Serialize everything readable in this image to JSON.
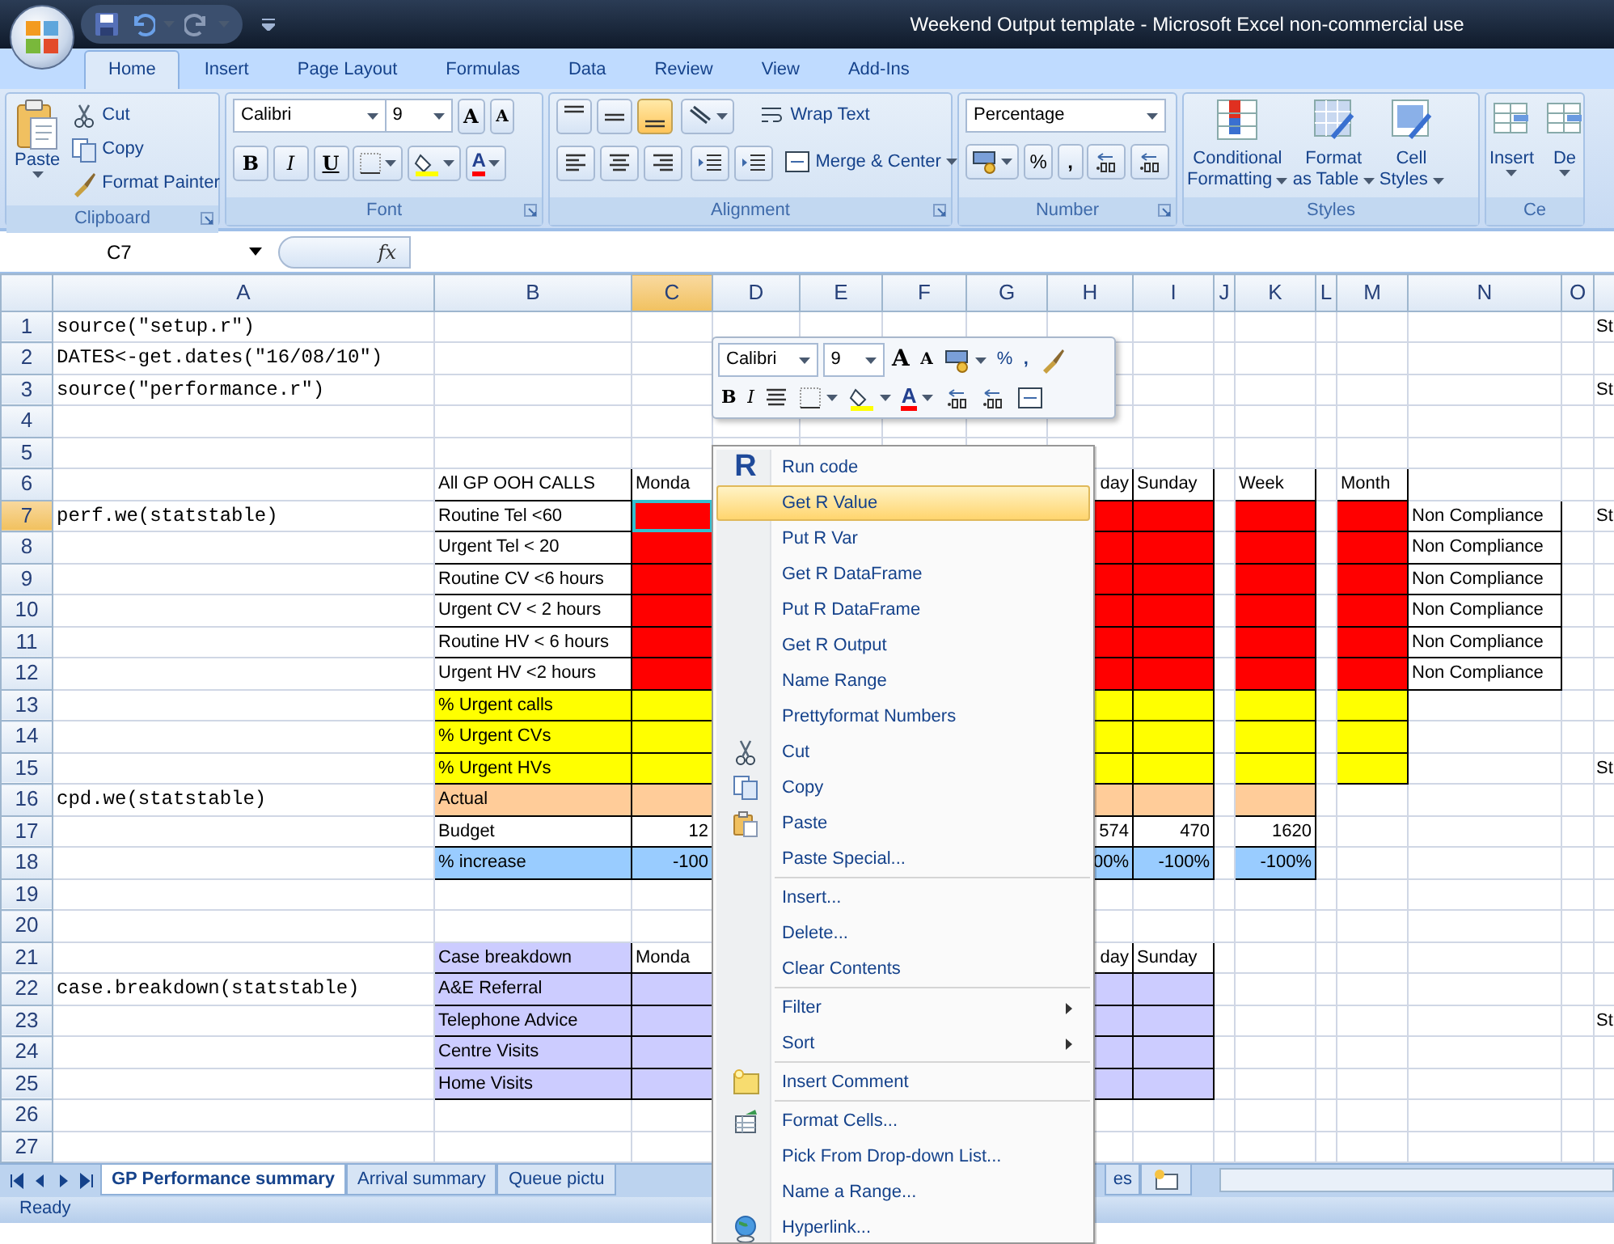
{
  "window": {
    "title": "Weekend Output template - Microsoft Excel non-commercial use"
  },
  "ribbon": {
    "tabs": [
      {
        "label": "Home",
        "selected": true
      },
      {
        "label": "Insert",
        "selected": false
      },
      {
        "label": "Page Layout",
        "selected": false
      },
      {
        "label": "Formulas",
        "selected": false
      },
      {
        "label": "Data",
        "selected": false
      },
      {
        "label": "Review",
        "selected": false
      },
      {
        "label": "View",
        "selected": false
      },
      {
        "label": "Add-Ins",
        "selected": false
      }
    ],
    "clipboard": {
      "label": "Clipboard",
      "paste": "Paste",
      "items": [
        "Cut",
        "Copy",
        "Format Painter"
      ]
    },
    "font": {
      "label": "Font",
      "font_name": "Calibri",
      "font_size": "9",
      "grow": "A",
      "shrink": "A",
      "styles": [
        "B",
        "I",
        "U"
      ],
      "color_letter": "A"
    },
    "alignment": {
      "label": "Alignment",
      "wrap": "Wrap Text",
      "merge": "Merge & Center",
      "bottom_align_on": true
    },
    "number": {
      "label": "Number",
      "format": "Percentage",
      "percent": "%",
      "comma": ","
    },
    "styles": {
      "label": "Styles",
      "buttons": [
        {
          "line1": "Conditional",
          "line2": "Formatting"
        },
        {
          "line1": "Format",
          "line2": "as Table"
        },
        {
          "line1": "Cell",
          "line2": "Styles"
        }
      ]
    },
    "cells": {
      "label": "Ce",
      "buttons": [
        "Insert",
        "De"
      ]
    }
  },
  "formula_bar": {
    "name_box": "C7",
    "fx": "fx"
  },
  "sheet": {
    "columns": [
      {
        "label": "A",
        "selected": false
      },
      {
        "label": "B",
        "selected": false
      },
      {
        "label": "C",
        "selected": true
      },
      {
        "label": "D",
        "selected": false
      },
      {
        "label": "E",
        "selected": false
      },
      {
        "label": "F",
        "selected": false
      },
      {
        "label": "G",
        "selected": false
      },
      {
        "label": "H",
        "selected": false
      },
      {
        "label": "I",
        "selected": false
      },
      {
        "label": "J",
        "selected": false
      },
      {
        "label": "K",
        "selected": false
      },
      {
        "label": "L",
        "selected": false
      },
      {
        "label": "M",
        "selected": false
      },
      {
        "label": "N",
        "selected": false
      },
      {
        "label": "O",
        "selected": false
      }
    ],
    "rows": [
      {
        "number": "1",
        "selected": false,
        "cells": [
          {
            "kind": "code",
            "text": "source(\"setup.r\")"
          },
          {},
          {},
          {},
          {},
          {},
          {},
          {},
          {},
          {},
          {},
          {},
          {},
          {},
          {},
          {
            "kind": "label",
            "text": "St"
          }
        ]
      },
      {
        "number": "2",
        "selected": false,
        "cells": [
          {
            "kind": "code",
            "text": "DATES<-get.dates(\"16/08/10\")"
          }
        ]
      },
      {
        "number": "3",
        "selected": false,
        "cells": [
          {
            "kind": "code",
            "text": "source(\"performance.r\")"
          },
          {},
          {},
          {},
          {},
          {},
          {},
          {},
          {},
          {},
          {},
          {},
          {},
          {},
          {},
          {
            "kind": "label",
            "text": "St"
          }
        ]
      },
      {
        "number": "4",
        "selected": false,
        "cells": []
      },
      {
        "number": "5",
        "selected": false,
        "cells": []
      },
      {
        "number": "6",
        "selected": false,
        "cells": [
          {},
          {
            "kind": "label",
            "text": "All GP OOH CALLS",
            "boxed": true
          },
          {
            "kind": "label",
            "text": "Monda",
            "boxed": true
          },
          {},
          {},
          {},
          {},
          {
            "kind": "tail",
            "text": "day",
            "boxed": true
          },
          {
            "kind": "label",
            "text": "Sunday",
            "boxed": true
          },
          {},
          {
            "kind": "label",
            "text": "Week",
            "boxed": true
          },
          {},
          {
            "kind": "label",
            "text": "Month",
            "boxed": true
          }
        ]
      },
      {
        "number": "7",
        "selected": true,
        "cells": [
          {
            "kind": "code",
            "text": "perf.we(statstable)"
          },
          {
            "kind": "label",
            "text": "Routine Tel <60",
            "boxed": true
          },
          {
            "kind": "label",
            "boxed": true,
            "color": "#ff0000",
            "active": true
          },
          {},
          {},
          {},
          {},
          {
            "kind": "label",
            "boxed": true,
            "color": "#ff0000"
          },
          {
            "kind": "label",
            "boxed": true,
            "color": "#ff0000"
          },
          {},
          {
            "kind": "label",
            "boxed": true,
            "color": "#ff0000"
          },
          {},
          {
            "kind": "label",
            "boxed": true,
            "color": "#ff0000"
          },
          {
            "kind": "label",
            "text": "Non Compliance",
            "boxed": true
          },
          {},
          {
            "kind": "label",
            "text": "St"
          }
        ]
      },
      {
        "number": "8",
        "selected": false,
        "cells": [
          {},
          {
            "kind": "label",
            "text": "Urgent Tel < 20",
            "boxed": true
          },
          {
            "kind": "label",
            "boxed": true,
            "color": "#ff0000"
          },
          {},
          {},
          {},
          {},
          {
            "kind": "label",
            "boxed": true,
            "color": "#ff0000"
          },
          {
            "kind": "label",
            "boxed": true,
            "color": "#ff0000"
          },
          {},
          {
            "kind": "label",
            "boxed": true,
            "color": "#ff0000"
          },
          {},
          {
            "kind": "label",
            "boxed": true,
            "color": "#ff0000"
          },
          {
            "kind": "label",
            "text": "Non Compliance",
            "boxed": true
          }
        ]
      },
      {
        "number": "9",
        "selected": false,
        "cells": [
          {},
          {
            "kind": "label",
            "text": "Routine CV <6 hours",
            "boxed": true
          },
          {
            "kind": "label",
            "boxed": true,
            "color": "#ff0000"
          },
          {},
          {},
          {},
          {},
          {
            "kind": "label",
            "boxed": true,
            "color": "#ff0000"
          },
          {
            "kind": "label",
            "boxed": true,
            "color": "#ff0000"
          },
          {},
          {
            "kind": "label",
            "boxed": true,
            "color": "#ff0000"
          },
          {},
          {
            "kind": "label",
            "boxed": true,
            "color": "#ff0000"
          },
          {
            "kind": "label",
            "text": "Non Compliance",
            "boxed": true
          }
        ]
      },
      {
        "number": "10",
        "selected": false,
        "cells": [
          {},
          {
            "kind": "label",
            "text": "Urgent CV < 2 hours",
            "boxed": true
          },
          {
            "kind": "label",
            "boxed": true,
            "color": "#ff0000"
          },
          {},
          {},
          {},
          {},
          {
            "kind": "label",
            "boxed": true,
            "color": "#ff0000"
          },
          {
            "kind": "label",
            "boxed": true,
            "color": "#ff0000"
          },
          {},
          {
            "kind": "label",
            "boxed": true,
            "color": "#ff0000"
          },
          {},
          {
            "kind": "label",
            "boxed": true,
            "color": "#ff0000"
          },
          {
            "kind": "label",
            "text": "Non Compliance",
            "boxed": true
          }
        ]
      },
      {
        "number": "11",
        "selected": false,
        "cells": [
          {},
          {
            "kind": "label",
            "text": "Routine HV < 6 hours",
            "boxed": true
          },
          {
            "kind": "label",
            "boxed": true,
            "color": "#ff0000"
          },
          {},
          {},
          {},
          {},
          {
            "kind": "label",
            "boxed": true,
            "color": "#ff0000"
          },
          {
            "kind": "label",
            "boxed": true,
            "color": "#ff0000"
          },
          {},
          {
            "kind": "label",
            "boxed": true,
            "color": "#ff0000"
          },
          {},
          {
            "kind": "label",
            "boxed": true,
            "color": "#ff0000"
          },
          {
            "kind": "label",
            "text": "Non Compliance",
            "boxed": true
          }
        ]
      },
      {
        "number": "12",
        "selected": false,
        "cells": [
          {},
          {
            "kind": "label",
            "text": "Urgent HV <2 hours",
            "boxed": true
          },
          {
            "kind": "label",
            "boxed": true,
            "color": "#ff0000"
          },
          {},
          {},
          {},
          {},
          {
            "kind": "label",
            "boxed": true,
            "color": "#ff0000"
          },
          {
            "kind": "label",
            "boxed": true,
            "color": "#ff0000"
          },
          {},
          {
            "kind": "label",
            "boxed": true,
            "color": "#ff0000"
          },
          {},
          {
            "kind": "label",
            "boxed": true,
            "color": "#ff0000"
          },
          {
            "kind": "label",
            "text": "Non Compliance",
            "boxed": true
          }
        ]
      },
      {
        "number": "13",
        "selected": false,
        "cells": [
          {},
          {
            "kind": "label",
            "text": "% Urgent calls",
            "boxed": true,
            "color": "#ffff00"
          },
          {
            "kind": "label",
            "boxed": true,
            "color": "#ffff00"
          },
          {},
          {},
          {},
          {},
          {
            "kind": "label",
            "boxed": true,
            "color": "#ffff00"
          },
          {
            "kind": "label",
            "boxed": true,
            "color": "#ffff00"
          },
          {},
          {
            "kind": "label",
            "boxed": true,
            "color": "#ffff00"
          },
          {},
          {
            "kind": "label",
            "boxed": true,
            "color": "#ffff00"
          }
        ]
      },
      {
        "number": "14",
        "selected": false,
        "cells": [
          {},
          {
            "kind": "label",
            "text": "% Urgent CVs",
            "boxed": true,
            "color": "#ffff00"
          },
          {
            "kind": "label",
            "boxed": true,
            "color": "#ffff00"
          },
          {},
          {},
          {},
          {},
          {
            "kind": "label",
            "boxed": true,
            "color": "#ffff00"
          },
          {
            "kind": "label",
            "boxed": true,
            "color": "#ffff00"
          },
          {},
          {
            "kind": "label",
            "boxed": true,
            "color": "#ffff00"
          },
          {},
          {
            "kind": "label",
            "boxed": true,
            "color": "#ffff00"
          }
        ]
      },
      {
        "number": "15",
        "selected": false,
        "cells": [
          {},
          {
            "kind": "label",
            "text": "% Urgent HVs",
            "boxed": true,
            "color": "#ffff00"
          },
          {
            "kind": "label",
            "boxed": true,
            "color": "#ffff00"
          },
          {},
          {},
          {},
          {},
          {
            "kind": "label",
            "boxed": true,
            "color": "#ffff00"
          },
          {
            "kind": "label",
            "boxed": true,
            "color": "#ffff00"
          },
          {},
          {
            "kind": "label",
            "boxed": true,
            "color": "#ffff00"
          },
          {},
          {
            "kind": "label",
            "boxed": true,
            "color": "#ffff00"
          },
          {},
          {},
          {
            "kind": "label",
            "text": "St"
          }
        ]
      },
      {
        "number": "16",
        "selected": false,
        "cells": [
          {
            "kind": "code",
            "text": "cpd.we(statstable)"
          },
          {
            "kind": "label",
            "text": "Actual",
            "boxed": true,
            "color": "#ffcc99"
          },
          {
            "kind": "label",
            "boxed": true,
            "color": "#ffcc99"
          },
          {},
          {},
          {},
          {},
          {
            "kind": "label",
            "boxed": true,
            "color": "#ffcc99"
          },
          {
            "kind": "label",
            "boxed": true,
            "color": "#ffcc99"
          },
          {},
          {
            "kind": "label",
            "boxed": true,
            "color": "#ffcc99"
          }
        ]
      },
      {
        "number": "17",
        "selected": false,
        "cells": [
          {},
          {
            "kind": "label",
            "text": "Budget",
            "boxed": true
          },
          {
            "kind": "number",
            "text": "12",
            "boxed": true
          },
          {},
          {},
          {},
          {},
          {
            "kind": "number",
            "text": "574",
            "boxed": true
          },
          {
            "kind": "number",
            "text": "470",
            "boxed": true
          },
          {},
          {
            "kind": "number",
            "text": "1620",
            "boxed": true
          }
        ]
      },
      {
        "number": "18",
        "selected": false,
        "cells": [
          {},
          {
            "kind": "label",
            "text": "% increase",
            "boxed": true,
            "color": "#99ccff"
          },
          {
            "kind": "number",
            "text": "-100",
            "boxed": true,
            "color": "#99ccff"
          },
          {},
          {},
          {},
          {},
          {
            "kind": "number",
            "text": "00%",
            "boxed": true,
            "color": "#99ccff"
          },
          {
            "kind": "number",
            "text": "-100%",
            "boxed": true,
            "color": "#99ccff"
          },
          {},
          {
            "kind": "number",
            "text": "-100%",
            "boxed": true,
            "color": "#99ccff"
          }
        ]
      },
      {
        "number": "19",
        "selected": false,
        "cells": []
      },
      {
        "number": "20",
        "selected": false,
        "cells": []
      },
      {
        "number": "21",
        "selected": false,
        "cells": [
          {},
          {
            "kind": "label",
            "text": "Case breakdown",
            "boxed": true,
            "color": "#ccccff"
          },
          {
            "kind": "label",
            "text": "Monda",
            "boxed": true
          },
          {},
          {},
          {},
          {},
          {
            "kind": "tail",
            "text": "day",
            "boxed": true
          },
          {
            "kind": "label",
            "text": "Sunday",
            "boxed": true
          }
        ]
      },
      {
        "number": "22",
        "selected": false,
        "cells": [
          {
            "kind": "code",
            "text": "case.breakdown(statstable)"
          },
          {
            "kind": "label",
            "text": "A&E Referral",
            "boxed": true,
            "color": "#ccccff"
          },
          {
            "kind": "label",
            "boxed": true,
            "color": "#ccccff"
          },
          {},
          {},
          {},
          {},
          {
            "kind": "label",
            "boxed": true,
            "color": "#ccccff"
          },
          {
            "kind": "label",
            "boxed": true,
            "color": "#ccccff"
          }
        ]
      },
      {
        "number": "23",
        "selected": false,
        "cells": [
          {},
          {
            "kind": "label",
            "text": "Telephone Advice",
            "boxed": true,
            "color": "#ccccff"
          },
          {
            "kind": "label",
            "boxed": true,
            "color": "#ccccff"
          },
          {},
          {},
          {},
          {},
          {
            "kind": "label",
            "boxed": true,
            "color": "#ccccff"
          },
          {
            "kind": "label",
            "boxed": true,
            "color": "#ccccff"
          },
          {},
          {},
          {},
          {},
          {},
          {},
          {
            "kind": "label",
            "text": "St"
          }
        ]
      },
      {
        "number": "24",
        "selected": false,
        "cells": [
          {},
          {
            "kind": "label",
            "text": "Centre Visits",
            "boxed": true,
            "color": "#ccccff"
          },
          {
            "kind": "label",
            "boxed": true,
            "color": "#ccccff"
          },
          {},
          {},
          {},
          {},
          {
            "kind": "label",
            "boxed": true,
            "color": "#ccccff"
          },
          {
            "kind": "label",
            "boxed": true,
            "color": "#ccccff"
          }
        ]
      },
      {
        "number": "25",
        "selected": false,
        "cells": [
          {},
          {
            "kind": "label",
            "text": "Home Visits",
            "boxed": true,
            "color": "#ccccff"
          },
          {
            "kind": "label",
            "boxed": true,
            "color": "#ccccff"
          },
          {},
          {},
          {},
          {},
          {
            "kind": "label",
            "boxed": true,
            "color": "#ccccff"
          },
          {
            "kind": "label",
            "boxed": true,
            "color": "#ccccff"
          }
        ]
      },
      {
        "number": "26",
        "selected": false,
        "cells": []
      },
      {
        "number": "27",
        "selected": false,
        "cells": []
      }
    ]
  },
  "mini_toolbar": {
    "font_name": "Calibri",
    "font_size": "9",
    "grow": "A",
    "shrink": "A",
    "percent": "%",
    "comma": ",",
    "bold": "B",
    "italic": "I",
    "color_letter": "A"
  },
  "context_menu": {
    "items": [
      {
        "kind": "item",
        "label": "Run code",
        "badge": "R",
        "selected": false
      },
      {
        "kind": "item",
        "label": "Get R Value",
        "selected": true
      },
      {
        "kind": "item",
        "label": "Put R Var",
        "selected": false
      },
      {
        "kind": "item",
        "label": "Get R DataFrame",
        "selected": false
      },
      {
        "kind": "item",
        "label": "Put R DataFrame",
        "selected": false
      },
      {
        "kind": "item",
        "label": "Get R Output",
        "selected": false
      },
      {
        "kind": "item",
        "label": "Name Range",
        "selected": false
      },
      {
        "kind": "item",
        "label": "Prettyformat Numbers",
        "selected": false
      },
      {
        "kind": "item",
        "label": "Cut",
        "selected": false
      },
      {
        "kind": "item",
        "label": "Copy",
        "selected": false
      },
      {
        "kind": "item",
        "label": "Paste",
        "selected": false
      },
      {
        "kind": "item",
        "label": "Paste Special...",
        "selected": false
      },
      {
        "kind": "separator"
      },
      {
        "kind": "item",
        "label": "Insert...",
        "selected": false
      },
      {
        "kind": "item",
        "label": "Delete...",
        "selected": false
      },
      {
        "kind": "item",
        "label": "Clear Contents",
        "selected": false
      },
      {
        "kind": "separator"
      },
      {
        "kind": "item",
        "label": "Filter",
        "submenu": true,
        "selected": false
      },
      {
        "kind": "item",
        "label": "Sort",
        "submenu": true,
        "selected": false
      },
      {
        "kind": "separator"
      },
      {
        "kind": "item",
        "label": "Insert Comment",
        "selected": false
      },
      {
        "kind": "separator"
      },
      {
        "kind": "item",
        "label": "Format Cells...",
        "selected": false
      },
      {
        "kind": "item",
        "label": "Pick From Drop-down List...",
        "selected": false
      },
      {
        "kind": "item",
        "label": "Name a Range...",
        "selected": false
      },
      {
        "kind": "item",
        "label": "Hyperlink...",
        "selected": false
      }
    ]
  },
  "sheet_tabs": [
    {
      "label": "GP Performance summary",
      "selected": true
    },
    {
      "label": "Arrival summary",
      "selected": false
    },
    {
      "label": "Queue pictu",
      "selected": false
    },
    {
      "label": "es",
      "selected": false
    }
  ],
  "status_bar": {
    "text": "Ready"
  }
}
